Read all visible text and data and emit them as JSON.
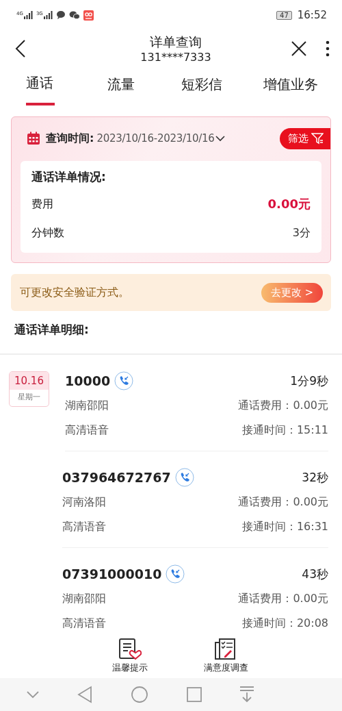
{
  "status_bar": {
    "signals": [
      "4G",
      "3G"
    ],
    "battery": "47",
    "time": "16:52"
  },
  "header": {
    "title": "详单查询",
    "subtitle": "131****7333"
  },
  "tabs": [
    {
      "label": "通话",
      "selected": true
    },
    {
      "label": "流量",
      "selected": false
    },
    {
      "label": "短彩信",
      "selected": false
    },
    {
      "label": "增值业务",
      "selected": false
    }
  ],
  "query": {
    "label": "查询时间:",
    "range": "2023/10/16-2023/10/16",
    "filter_button": "筛选"
  },
  "summary": {
    "title": "通话详单情况:",
    "rows": [
      {
        "label": "费用",
        "value": "0.00元",
        "highlight": true
      },
      {
        "label": "分钟数",
        "value": "3分",
        "highlight": false
      }
    ]
  },
  "notice": {
    "text": "可更改安全验证方式。",
    "button": "去更改 >"
  },
  "section_title": "通话详单明细:",
  "calls": [
    {
      "date": "10.16",
      "weekday": "星期一",
      "number": "10000",
      "duration": "1分9秒",
      "location": "湖南邵阳",
      "fee": "通话费用：0.00元",
      "type": "高清语音",
      "connected": "接通时间：15:11"
    },
    {
      "number": "037964672767",
      "duration": "32秒",
      "location": "河南洛阳",
      "fee": "通话费用：0.00元",
      "type": "高清语音",
      "connected": "接通时间：16:31"
    },
    {
      "number": "07391000010",
      "duration": "43秒",
      "location": "湖南邵阳",
      "fee": "通话费用：0.00元",
      "type": "高清语音",
      "connected": "接通时间：20:08"
    }
  ],
  "bottom_actions": [
    {
      "kind": "tips",
      "label": "温馨提示"
    },
    {
      "kind": "survey",
      "label": "满意度调查"
    }
  ]
}
